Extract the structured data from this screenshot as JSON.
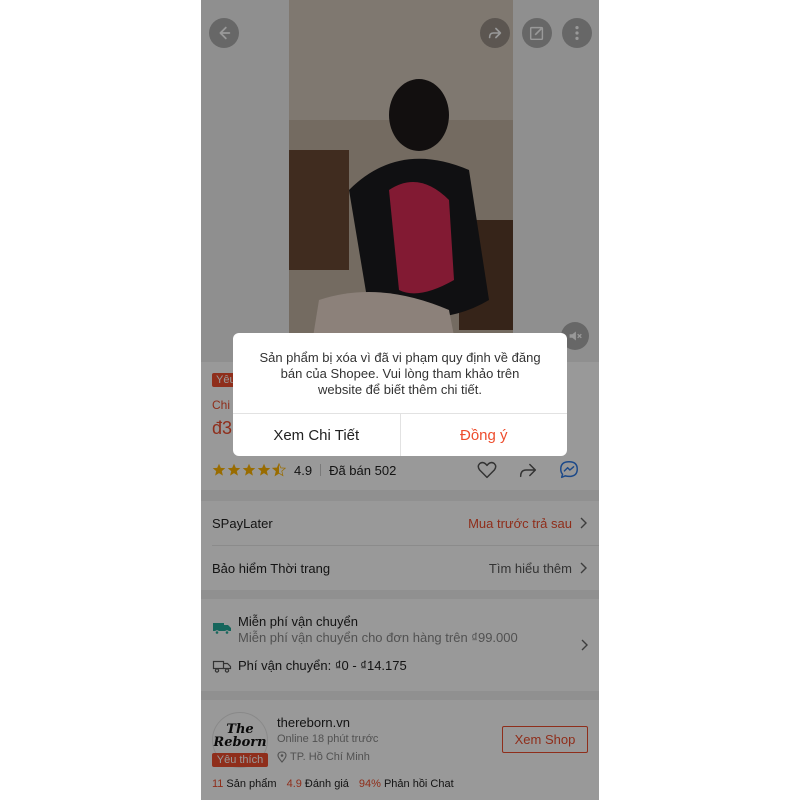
{
  "colors": {
    "accent": "#ee4d2d",
    "messenger": "#2f7ae5",
    "star": "#ffb400"
  },
  "top_actions": {
    "back_icon": "arrow-left-icon",
    "share_icon": "share-icon",
    "edit_icon": "edit-icon",
    "more_icon": "more-vertical-icon",
    "mute_icon": "mute-icon"
  },
  "product": {
    "fav_badge": "Yêu",
    "chi_text": "Chi",
    "price_partial": "đ3",
    "rating_value": "4.9",
    "rating_stars": 4.5,
    "sold": "Đã bán 502"
  },
  "rows": {
    "spaylater": {
      "label": "SPayLater",
      "link": "Mua trước trả sau"
    },
    "insurance": {
      "label": "Bảo hiểm Thời trang",
      "link": "Tìm hiểu thêm"
    }
  },
  "shipping": {
    "free_title": "Miễn phí vận chuyển",
    "free_sub": "Miễn phí vận chuyển cho đơn hàng trên ₫99.000",
    "fee": "Phí vận chuyển: ₫0 - ₫14.175"
  },
  "shop": {
    "logo_line1": "The",
    "logo_line2": "Reborn",
    "fav_label": "Yêu thích",
    "name": "thereborn.vn",
    "online": "Online 18 phút trước",
    "location": "TP. Hồ Chí Minh",
    "view_button": "Xem Shop",
    "stats": [
      {
        "num": "11",
        "label": "Sản phẩm"
      },
      {
        "num": "4.9",
        "label": "Đánh giá"
      },
      {
        "num": "94%",
        "label": "Phản hồi Chat"
      }
    ]
  },
  "dialog": {
    "line1": "Sản phẩm bị xóa vì đã vi phạm quy định về đăng",
    "line2": "bán của Shopee. Vui lòng tham khảo trên",
    "line3": "website để biết thêm chi tiết.",
    "detail_button": "Xem Chi Tiết",
    "ok_button": "Đồng ý"
  }
}
